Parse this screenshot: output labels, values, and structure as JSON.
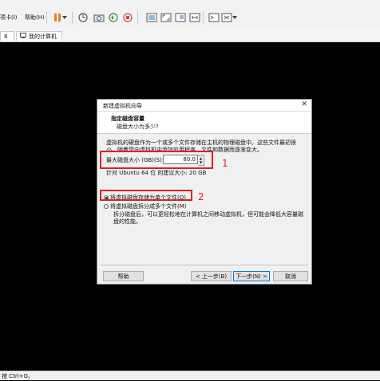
{
  "menubar": {
    "items": [
      {
        "label": "项卡(I)"
      },
      {
        "label": "帮助(H)"
      }
    ]
  },
  "tabs": [
    {
      "label": "8"
    },
    {
      "label": "我的计算机"
    }
  ],
  "dialog": {
    "title": "新建虚拟机向导",
    "header_title": "指定磁盘容量",
    "header_subtitle": "磁盘大小为多少?",
    "description": "虚拟机的硬盘作为一个或多个文件存储在主机的物理磁盘中。这些文件最初很小，随着您向虚拟机中添加应用程序、文件和数据而逐渐变大。",
    "max_disk_label": "最大磁盘大小 (GB)(S):",
    "max_disk_value": "80.0",
    "recommended_text": "针对 Ubuntu 64 位 的建议大小: 20 GB",
    "radio_single": "将虚拟磁盘存储为单个文件(O)",
    "radio_multi": "将虚拟磁盘拆分成多个文件(M)",
    "split_desc": "拆分磁盘后，可以更轻松地在计算机之间移动虚拟机，但可能会降低大容量磁盘的性能。",
    "buttons": {
      "help": "帮助",
      "back": "< 上一步(B)",
      "next": "下一步(N) >",
      "cancel": "取消"
    }
  },
  "annotations": {
    "one": "1",
    "two": "2"
  },
  "statusbar": {
    "text": "按 Ctrl+G。"
  },
  "colors": {
    "annotation": "#e02020",
    "vm_background": "#000000",
    "accent": "#0078d7"
  }
}
